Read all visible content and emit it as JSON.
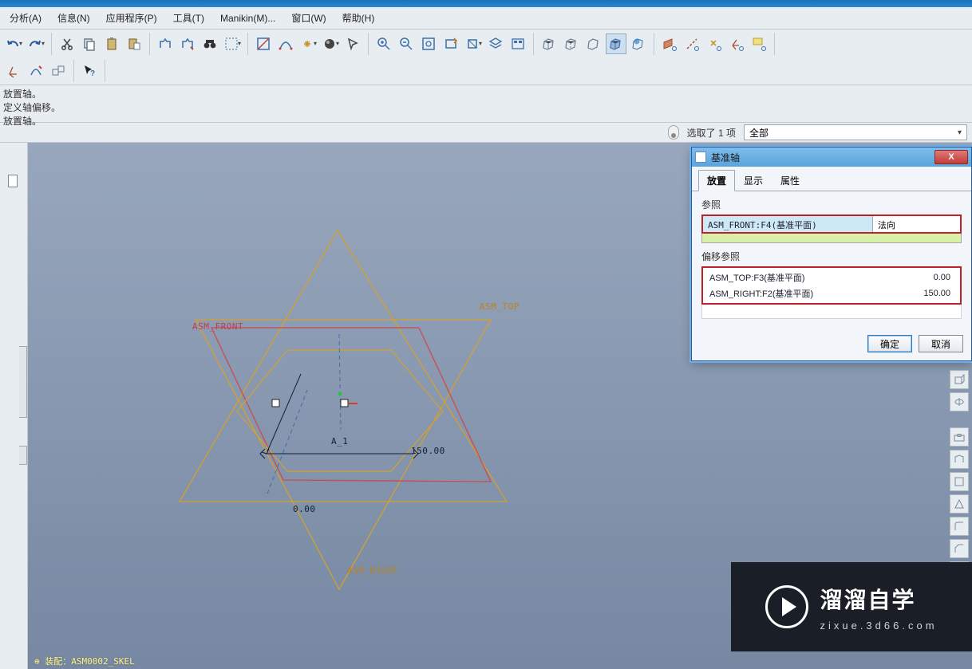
{
  "menubar": {
    "items": [
      "分析(A)",
      "信息(N)",
      "应用程序(P)",
      "工具(T)",
      "Manikin(M)...",
      "窗口(W)",
      "帮助(H)"
    ]
  },
  "messages": {
    "l1": "放置轴。",
    "l2": "定义轴偏移。",
    "l3": "放置轴。"
  },
  "selection": {
    "text": "选取了 1 项",
    "filter": "全部"
  },
  "scene": {
    "labels": {
      "front": "ASM_FRONT",
      "top": "ASM_TOP",
      "right": "ASM_RIGHT",
      "axis": "A_1"
    },
    "dims": {
      "d150": "150.00",
      "d0": "0.00"
    },
    "bottom_text": "⊕ 装配：ASM0002_SKEL"
  },
  "dialog": {
    "title": "基准轴",
    "tabs": [
      "放置",
      "显示",
      "属性"
    ],
    "active_tab": 0,
    "ref_label": "参照",
    "ref": {
      "name": "ASM_FRONT:F4(基准平面)",
      "type": "法向"
    },
    "offset_label": "偏移参照",
    "offsets": [
      {
        "name": "ASM_TOP:F3(基准平面)",
        "value": "0.00"
      },
      {
        "name": "ASM_RIGHT:F2(基准平面)",
        "value": "150.00"
      }
    ],
    "ok": "确定",
    "cancel": "取消",
    "close_x": "X"
  },
  "watermark": {
    "big": "溜溜自学",
    "small": "zixue.3d66.com"
  }
}
